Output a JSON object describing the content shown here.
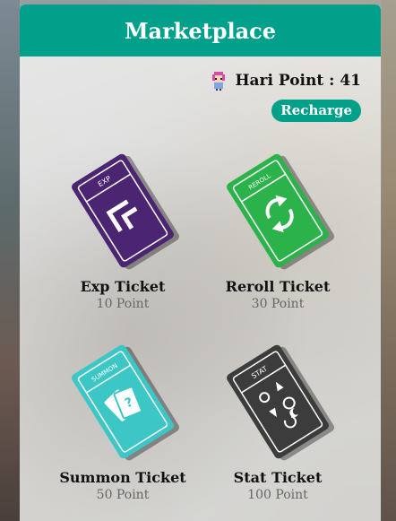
{
  "header": {
    "title": "Marketplace"
  },
  "user": {
    "points_label": "Hari Point : 41"
  },
  "recharge": {
    "label": "Recharge"
  },
  "tickets": [
    {
      "name": "Exp Ticket",
      "price": "10 Point",
      "tag": "EXP",
      "color": "#4b2472",
      "icon": "double-chevron-icon"
    },
    {
      "name": "Reroll Ticket",
      "price": "30 Point",
      "tag": "REROLL",
      "color": "#2cb24a",
      "icon": "refresh-icon"
    },
    {
      "name": "Summon Ticket",
      "price": "50 Point",
      "tag": "SUMMON",
      "color": "#3cc6c6",
      "icon": "summon-card-icon"
    },
    {
      "name": "Stat Ticket",
      "price": "100 Point",
      "tag": "STAT",
      "color": "#3c3c3c",
      "icon": "stat-symbols-icon"
    }
  ],
  "colors": {
    "accent": "#00a08a"
  }
}
